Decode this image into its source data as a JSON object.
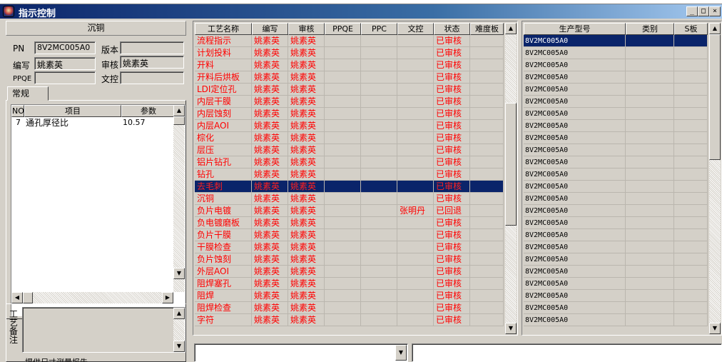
{
  "window": {
    "title": "指示控制",
    "min": "_",
    "max": "□",
    "close": "×"
  },
  "left": {
    "header": "沉铜",
    "pn_label": "PN",
    "pn_value": "8V2MC005A0",
    "version_label": "版本",
    "version_value": "",
    "author_label": "编写",
    "author_value": "姚素英",
    "review_label": "审核",
    "review_value": "姚素英",
    "ppqe_label": "PPQE",
    "ppqe_value": "",
    "doc_label": "文控",
    "doc_value": "",
    "tab": "常规",
    "param_table": {
      "headers": [
        "NO",
        "项目",
        "参数"
      ],
      "rows": [
        {
          "no": "7",
          "item": "通孔厚径比",
          "value": "10.57"
        }
      ]
    },
    "notes_label": "工艺备注",
    "notes_bottom": "提供尺寸测量报告"
  },
  "process_grid": {
    "headers": [
      "工艺名称",
      "编写",
      "审核",
      "PPQE",
      "PPC",
      "文控",
      "状态",
      "难度板"
    ],
    "selected_index": 12,
    "rows": [
      {
        "name": "流程指示",
        "author": "姚素英",
        "review": "姚素英",
        "ppqe": "",
        "ppc": "",
        "doc": "",
        "status": "已审核",
        "hard": ""
      },
      {
        "name": "计划投料",
        "author": "姚素英",
        "review": "姚素英",
        "ppqe": "",
        "ppc": "",
        "doc": "",
        "status": "已审核",
        "hard": ""
      },
      {
        "name": "开料",
        "author": "姚素英",
        "review": "姚素英",
        "ppqe": "",
        "ppc": "",
        "doc": "",
        "status": "已审核",
        "hard": ""
      },
      {
        "name": "开料后烘板",
        "author": "姚素英",
        "review": "姚素英",
        "ppqe": "",
        "ppc": "",
        "doc": "",
        "status": "已审核",
        "hard": ""
      },
      {
        "name": "LDI定位孔",
        "author": "姚素英",
        "review": "姚素英",
        "ppqe": "",
        "ppc": "",
        "doc": "",
        "status": "已审核",
        "hard": ""
      },
      {
        "name": "内层干膜",
        "author": "姚素英",
        "review": "姚素英",
        "ppqe": "",
        "ppc": "",
        "doc": "",
        "status": "已审核",
        "hard": ""
      },
      {
        "name": "内层蚀刻",
        "author": "姚素英",
        "review": "姚素英",
        "ppqe": "",
        "ppc": "",
        "doc": "",
        "status": "已审核",
        "hard": ""
      },
      {
        "name": "内层AOI",
        "author": "姚素英",
        "review": "姚素英",
        "ppqe": "",
        "ppc": "",
        "doc": "",
        "status": "已审核",
        "hard": ""
      },
      {
        "name": "棕化",
        "author": "姚素英",
        "review": "姚素英",
        "ppqe": "",
        "ppc": "",
        "doc": "",
        "status": "已审核",
        "hard": ""
      },
      {
        "name": "层压",
        "author": "姚素英",
        "review": "姚素英",
        "ppqe": "",
        "ppc": "",
        "doc": "",
        "status": "已审核",
        "hard": ""
      },
      {
        "name": "铝片钻孔",
        "author": "姚素英",
        "review": "姚素英",
        "ppqe": "",
        "ppc": "",
        "doc": "",
        "status": "已审核",
        "hard": ""
      },
      {
        "name": "钻孔",
        "author": "姚素英",
        "review": "姚素英",
        "ppqe": "",
        "ppc": "",
        "doc": "",
        "status": "已审核",
        "hard": ""
      },
      {
        "name": "去毛刺",
        "author": "姚素英",
        "review": "姚素英",
        "ppqe": "",
        "ppc": "",
        "doc": "",
        "status": "已审核",
        "hard": ""
      },
      {
        "name": "沉铜",
        "author": "姚素英",
        "review": "姚素英",
        "ppqe": "",
        "ppc": "",
        "doc": "",
        "status": "已审核",
        "hard": ""
      },
      {
        "name": "负片电镀",
        "author": "姚素英",
        "review": "姚素英",
        "ppqe": "",
        "ppc": "",
        "doc": "张明丹",
        "status": "已回退",
        "hard": ""
      },
      {
        "name": "负电镀磨板",
        "author": "姚素英",
        "review": "姚素英",
        "ppqe": "",
        "ppc": "",
        "doc": "",
        "status": "已审核",
        "hard": ""
      },
      {
        "name": "负片干膜",
        "author": "姚素英",
        "review": "姚素英",
        "ppqe": "",
        "ppc": "",
        "doc": "",
        "status": "已审核",
        "hard": ""
      },
      {
        "name": "干膜检查",
        "author": "姚素英",
        "review": "姚素英",
        "ppqe": "",
        "ppc": "",
        "doc": "",
        "status": "已审核",
        "hard": ""
      },
      {
        "name": "负片蚀刻",
        "author": "姚素英",
        "review": "姚素英",
        "ppqe": "",
        "ppc": "",
        "doc": "",
        "status": "已审核",
        "hard": ""
      },
      {
        "name": "外层AOI",
        "author": "姚素英",
        "review": "姚素英",
        "ppqe": "",
        "ppc": "",
        "doc": "",
        "status": "已审核",
        "hard": ""
      },
      {
        "name": "阻焊塞孔",
        "author": "姚素英",
        "review": "姚素英",
        "ppqe": "",
        "ppc": "",
        "doc": "",
        "status": "已审核",
        "hard": ""
      },
      {
        "name": "阻焊",
        "author": "姚素英",
        "review": "姚素英",
        "ppqe": "",
        "ppc": "",
        "doc": "",
        "status": "已审核",
        "hard": ""
      },
      {
        "name": "阻焊检查",
        "author": "姚素英",
        "review": "姚素英",
        "ppqe": "",
        "ppc": "",
        "doc": "",
        "status": "已审核",
        "hard": ""
      },
      {
        "name": "字符",
        "author": "姚素英",
        "review": "姚素英",
        "ppqe": "",
        "ppc": "",
        "doc": "",
        "status": "已审核",
        "hard": ""
      }
    ]
  },
  "model_grid": {
    "headers": [
      "生产型号",
      "类别",
      "S板"
    ],
    "model_value": "8V2MC005A0",
    "row_count": 24,
    "selected_index": 0
  },
  "scroll_arrows": {
    "up": "▲",
    "down": "▼",
    "left": "◀",
    "right": "▶"
  }
}
